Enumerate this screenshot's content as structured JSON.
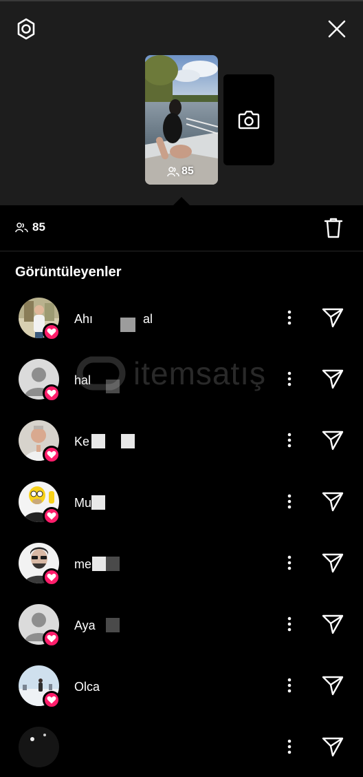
{
  "header": {
    "settings_icon": "gear-icon",
    "close_icon": "close-icon",
    "story_view_count": "85",
    "add_story_icon": "camera-icon"
  },
  "stats": {
    "viewer_count": "85",
    "delete_icon": "trash-icon"
  },
  "section_title": "Görüntüleyenler",
  "viewers": [
    {
      "name": "Ahı",
      "name_tail": "al",
      "liked": true
    },
    {
      "name": "hal",
      "name_tail": "",
      "liked": true
    },
    {
      "name": "Ke",
      "name_tail": "",
      "liked": true
    },
    {
      "name": "Mu",
      "name_tail": "",
      "liked": true
    },
    {
      "name": "me",
      "name_tail": "",
      "liked": true
    },
    {
      "name": "Aya",
      "name_tail": "",
      "liked": true
    },
    {
      "name": "Olca",
      "name_tail": "",
      "liked": true
    }
  ],
  "watermark": "itemsatış",
  "colors": {
    "like_badge": "#ff1e6b",
    "header_bg": "#1d1d1d",
    "background": "#000000"
  }
}
